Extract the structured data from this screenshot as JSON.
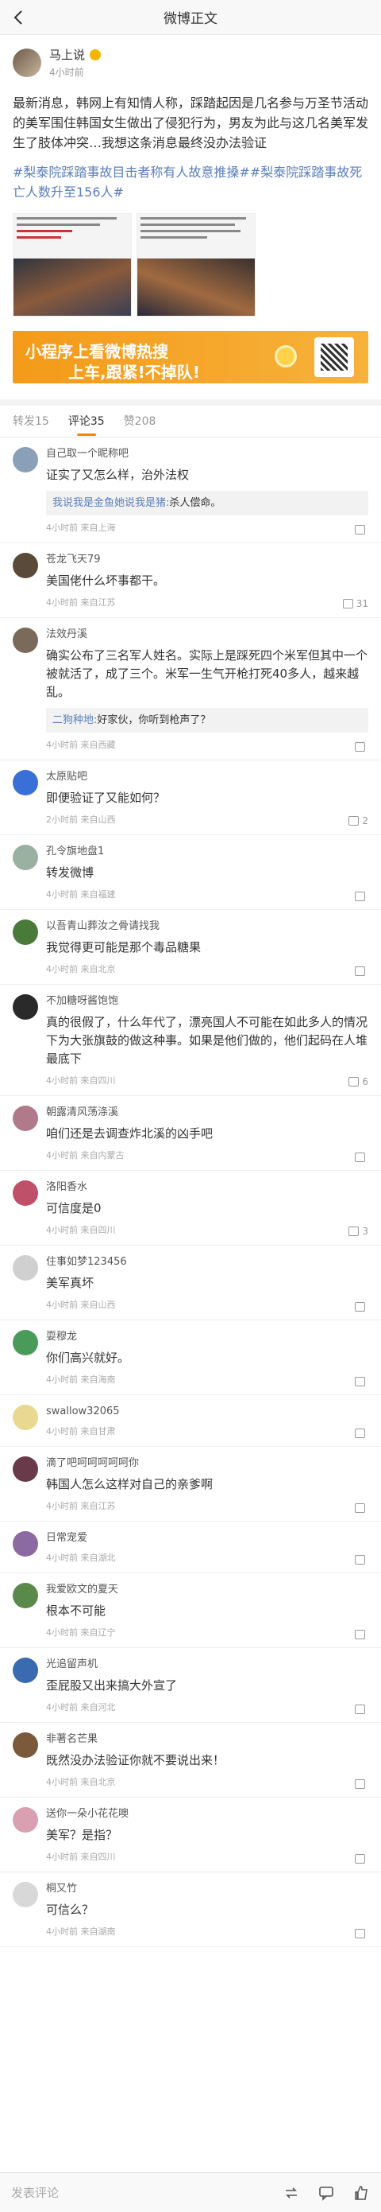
{
  "nav": {
    "title": "微博正文"
  },
  "post": {
    "author": "马上说",
    "time": "4小时前",
    "body": "最新消息，韩网上有知情人称，踩踏起因是几名参与万圣节活动的美军围住韩国女生做出了侵犯行为，男友为此与这几名美军发生了肢体冲突…我想这条消息最终没办法验证",
    "tags": "#梨泰院踩踏事故目击者称有人故意推搡##梨泰院踩踏事故死亡人数升至156人#"
  },
  "banner": {
    "line1": "小程序上看微博热搜",
    "line2": "上车,跟紧!不掉队!"
  },
  "tabs": {
    "repost": "转发15",
    "comment": "评论35",
    "like": "赞208"
  },
  "comments": [
    {
      "name": "自己取一个昵称吧",
      "text": "证实了又怎么样，治外法权",
      "reply_name": "我说我是金鱼她说我是猪:",
      "reply_text": "杀人偿命。",
      "meta": "4小时前 来自上海",
      "likes": "",
      "avatar": "#8aa0b8"
    },
    {
      "name": "苍龙飞天79",
      "text": "美国佬什么坏事都干。",
      "reply_name": "",
      "reply_text": "",
      "meta": "4小时前 来自江苏",
      "likes": "31",
      "avatar": "#5a4a3a"
    },
    {
      "name": "法效丹溪",
      "text": "确实公布了三名军人姓名。实际上是踩死四个米军但其中一个被就活了，成了三个。米军一生气开枪打死40多人，越来越乱。",
      "reply_name": "二狗种地:",
      "reply_text": "好家伙，你听到枪声了？",
      "meta": "4小时前 来自西藏",
      "likes": "",
      "avatar": "#7a6a5a"
    },
    {
      "name": "太原贴吧",
      "text": "即便验证了又能如何？",
      "reply_name": "",
      "reply_text": "",
      "meta": "2小时前 来自山西",
      "likes": "2",
      "avatar": "#3a6fd8"
    },
    {
      "name": "孔令旗地盘1",
      "text": "转发微博",
      "reply_name": "",
      "reply_text": "",
      "meta": "4小时前 来自福建",
      "likes": "",
      "avatar": "#9ab0a0"
    },
    {
      "name": "以吾青山葬汝之骨请找我",
      "text": "我觉得更可能是那个毒品糖果",
      "reply_name": "",
      "reply_text": "",
      "meta": "4小时前 来自北京",
      "likes": "",
      "avatar": "#4a7a3a"
    },
    {
      "name": "不加糖呀酱饱饱",
      "text": "真的很假了，什么年代了，漂亮国人不可能在如此多人的情况下为大张旗鼓的做这种事。如果是他们做的，他们起码在人堆最底下",
      "reply_name": "",
      "reply_text": "",
      "meta": "4小时前 来自四川",
      "likes": "6",
      "avatar": "#2a2a2a"
    },
    {
      "name": "朝露清风荡涤溪",
      "text": "咱们还是去调查炸北溪的凶手吧",
      "reply_name": "",
      "reply_text": "",
      "meta": "4小时前 来自内蒙古",
      "likes": "",
      "avatar": "#b07a8a"
    },
    {
      "name": "洛阳香水",
      "text": "可信度是0",
      "reply_name": "",
      "reply_text": "",
      "meta": "4小时前 来自四川",
      "likes": "3",
      "avatar": "#c0506a"
    },
    {
      "name": "住事如梦123456",
      "text": "美军真坏",
      "reply_name": "",
      "reply_text": "",
      "meta": "4小时前 来自山西",
      "likes": "",
      "avatar": "#d0d0d0"
    },
    {
      "name": "耍穆龙",
      "text": "你们高兴就好。",
      "reply_name": "",
      "reply_text": "",
      "meta": "4小时前 来自海南",
      "likes": "",
      "avatar": "#4a9a5a"
    },
    {
      "name": "swallow32065",
      "text": "",
      "reply_name": "",
      "reply_text": "",
      "meta": "4小时前 来自甘肃",
      "likes": "",
      "avatar": "#e8d890"
    },
    {
      "name": "滴了吧呵呵呵呵呵你",
      "text": "韩国人怎么这样对自己的亲爹啊",
      "reply_name": "",
      "reply_text": "",
      "meta": "4小时前 来自江苏",
      "likes": "",
      "avatar": "#6a3a4a"
    },
    {
      "name": "日常宠爱",
      "text": "",
      "reply_name": "",
      "reply_text": "",
      "meta": "4小时前 来自湖北",
      "likes": "",
      "avatar": "#8a6aa0"
    },
    {
      "name": "我爱欧文的夏天",
      "text": "根本不可能",
      "reply_name": "",
      "reply_text": "",
      "meta": "4小时前 来自辽宁",
      "likes": "",
      "avatar": "#5a8a4a"
    },
    {
      "name": "光追留声机",
      "text": "歪屁股又出来搞大外宣了",
      "reply_name": "",
      "reply_text": "",
      "meta": "4小时前 来自河北",
      "likes": "",
      "avatar": "#3a6ab0"
    },
    {
      "name": "非著名芒果",
      "text": "既然没办法验证你就不要说出来！",
      "reply_name": "",
      "reply_text": "",
      "meta": "4小时前 来自北京",
      "likes": "",
      "avatar": "#7a5a3a"
    },
    {
      "name": "送你一朵小花花噢",
      "text": "美军？是指？",
      "reply_name": "",
      "reply_text": "",
      "meta": "4小时前 来自四川",
      "likes": "",
      "avatar": "#d8a0b0"
    },
    {
      "name": "桐又竹",
      "text": "可信么？",
      "reply_name": "",
      "reply_text": "",
      "meta": "4小时前 来自湖南",
      "likes": "",
      "avatar": "#d8d8d8"
    }
  ],
  "bottom": {
    "placeholder": "发表评论"
  }
}
